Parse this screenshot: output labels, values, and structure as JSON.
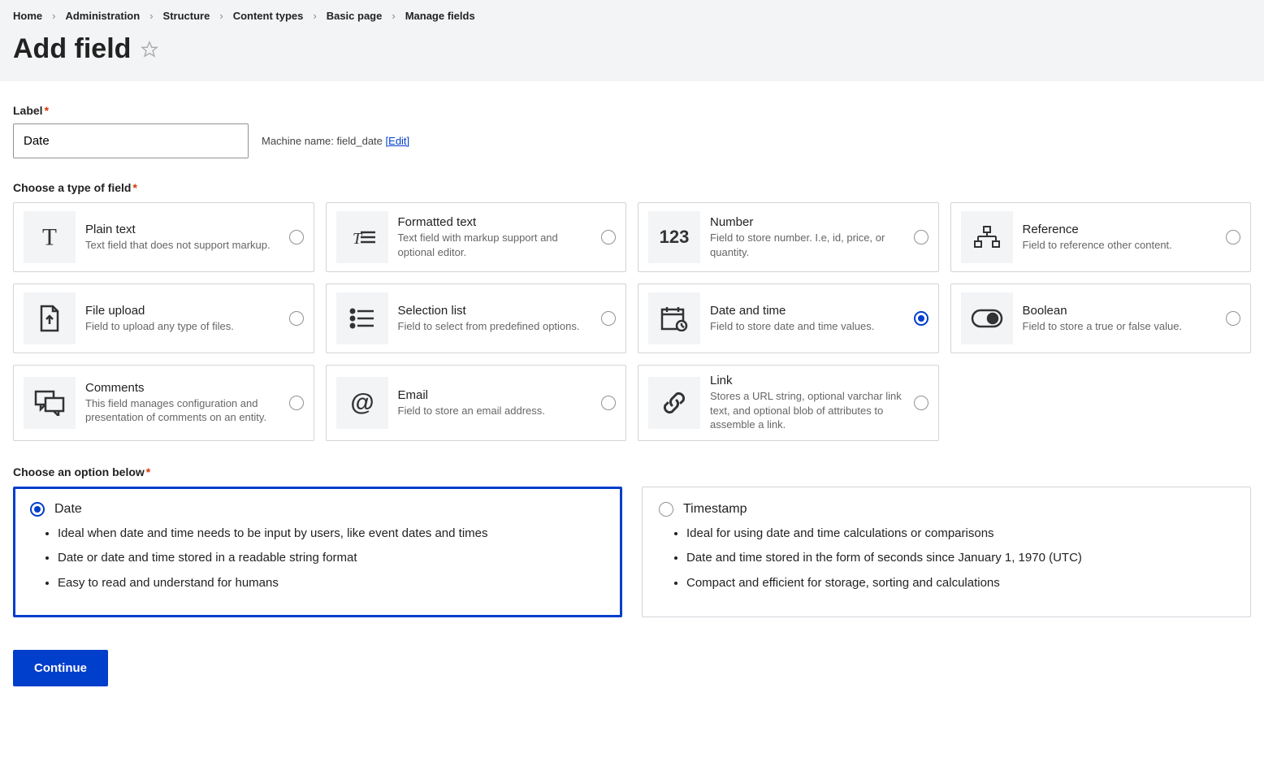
{
  "breadcrumb": [
    "Home",
    "Administration",
    "Structure",
    "Content types",
    "Basic page",
    "Manage fields"
  ],
  "page_title": "Add field",
  "label_heading": "Label",
  "label_value": "Date",
  "machine_name_prefix": "Machine name:",
  "machine_name_value": "field_date",
  "machine_name_edit": "[Edit]",
  "field_type_heading": "Choose a type of field",
  "field_types": [
    {
      "id": "plain_text",
      "title": "Plain text",
      "desc": "Text field that does not support markup.",
      "icon": "T",
      "selected": false
    },
    {
      "id": "formatted_text",
      "title": "Formatted text",
      "desc": "Text field with markup support and optional editor.",
      "icon": "Tfmt",
      "selected": false
    },
    {
      "id": "number",
      "title": "Number",
      "desc": "Field to store number. I.e, id, price, or quantity.",
      "icon": "123",
      "selected": false
    },
    {
      "id": "reference",
      "title": "Reference",
      "desc": "Field to reference other content.",
      "icon": "ref",
      "selected": false
    },
    {
      "id": "file_upload",
      "title": "File upload",
      "desc": "Field to upload any type of files.",
      "icon": "file",
      "selected": false
    },
    {
      "id": "selection_list",
      "title": "Selection list",
      "desc": "Field to select from predefined options.",
      "icon": "list",
      "selected": false
    },
    {
      "id": "date_time",
      "title": "Date and time",
      "desc": "Field to store date and time values.",
      "icon": "date",
      "selected": true
    },
    {
      "id": "boolean",
      "title": "Boolean",
      "desc": "Field to store a true or false value.",
      "icon": "toggle",
      "selected": false
    },
    {
      "id": "comments",
      "title": "Comments",
      "desc": "This field manages configuration and presentation of comments on an entity.",
      "icon": "comment",
      "selected": false
    },
    {
      "id": "email",
      "title": "Email",
      "desc": "Field to store an email address.",
      "icon": "at",
      "selected": false
    },
    {
      "id": "link",
      "title": "Link",
      "desc": "Stores a URL string, optional varchar link text, and optional blob of attributes to assemble a link.",
      "icon": "link",
      "selected": false
    }
  ],
  "option_heading": "Choose an option below",
  "options": [
    {
      "id": "date",
      "title": "Date",
      "selected": true,
      "bullets": [
        "Ideal when date and time needs to be input by users, like event dates and times",
        "Date or date and time stored in a readable string format",
        "Easy to read and understand for humans"
      ]
    },
    {
      "id": "timestamp",
      "title": "Timestamp",
      "selected": false,
      "bullets": [
        "Ideal for using date and time calculations or comparisons",
        "Date and time stored in the form of seconds since January 1, 1970 (UTC)",
        "Compact and efficient for storage, sorting and calculations"
      ]
    }
  ],
  "continue_label": "Continue"
}
